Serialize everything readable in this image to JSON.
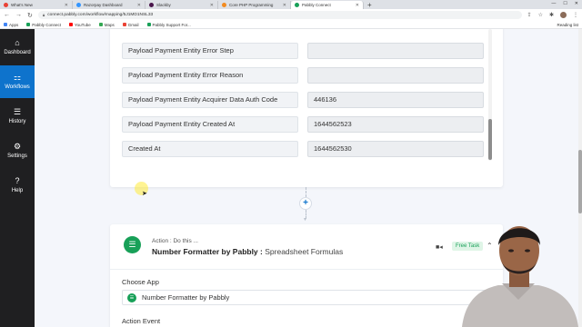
{
  "browser": {
    "tabs": [
      {
        "title": "What's New",
        "color": "#e94235",
        "active": false
      },
      {
        "title": "Razorpay Dashboard",
        "color": "#3395ff",
        "active": false
      },
      {
        "title": "Slackby",
        "color": "#4a154b",
        "active": false
      },
      {
        "title": "Core PHP Programming",
        "color": "#f28b20",
        "active": false
      },
      {
        "title": "Pabbly Connect",
        "color": "#18a058",
        "active": true
      }
    ],
    "url": "connect.pabbly.com/workflow/mapping/5J1MD1NSL33",
    "bookmarks": [
      {
        "label": "Apps",
        "color": "#4285f4"
      },
      {
        "label": "Pabbly Connect",
        "color": "#18a058"
      },
      {
        "label": "YouTube",
        "color": "#ff0000"
      },
      {
        "label": "Maps",
        "color": "#34a853"
      },
      {
        "label": "Gmail",
        "color": "#ea4335"
      },
      {
        "label": "Pabbly Support For...",
        "color": "#18a058"
      }
    ],
    "reading_list": "Reading list"
  },
  "sidebar": {
    "items": [
      {
        "label": "Dashboard",
        "icon": "home-icon",
        "glyph": "⌂",
        "active": false
      },
      {
        "label": "Workflows",
        "icon": "workflows-icon",
        "glyph": "⚏",
        "active": true
      },
      {
        "label": "History",
        "icon": "history-icon",
        "glyph": "☰",
        "active": false
      },
      {
        "label": "Settings",
        "icon": "gear-icon",
        "glyph": "⚙",
        "active": false
      },
      {
        "label": "Help",
        "icon": "help-icon",
        "glyph": "?",
        "active": false
      }
    ]
  },
  "response_fields": [
    {
      "name": "Payload Payment Entity Error Step",
      "value": ""
    },
    {
      "name": "Payload Payment Entity Error Reason",
      "value": ""
    },
    {
      "name": "Payload Payment Entity Acquirer Data Auth Code",
      "value": "446136"
    },
    {
      "name": "Payload Payment Entity Created At",
      "value": "1644562523"
    },
    {
      "name": "Created At",
      "value": "1644562530"
    }
  ],
  "action": {
    "label": "Action : Do this ...",
    "title": "Number Formatter by Pabbly :",
    "subtitle": "Spreadsheet Formulas",
    "badge": "Free Task",
    "choose_app_label": "Choose App",
    "selected_app": "Number Formatter by Pabbly",
    "action_event_label": "Action Event"
  },
  "colors": {
    "accent": "#0e73cc",
    "success": "#18a058",
    "sidebar_bg": "#1f1f21"
  }
}
